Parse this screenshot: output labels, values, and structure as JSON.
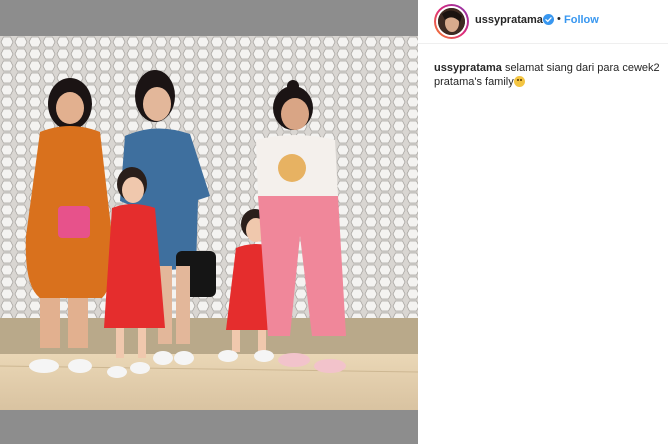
{
  "post": {
    "username": "ussypratama",
    "separator": "•",
    "follow_label": "Follow",
    "caption_user": "ussypratama",
    "caption_text": "selamat siang dari para cewek2 pratama's family",
    "caption_emoji": "grinning-face"
  },
  "colors": {
    "follow": "#3897f0",
    "verified": "#3897f0",
    "text": "#262626",
    "photo_frame": "#8d8d8d"
  },
  "icons": [
    "verified-badge-icon",
    "grinning-face-emoji"
  ]
}
